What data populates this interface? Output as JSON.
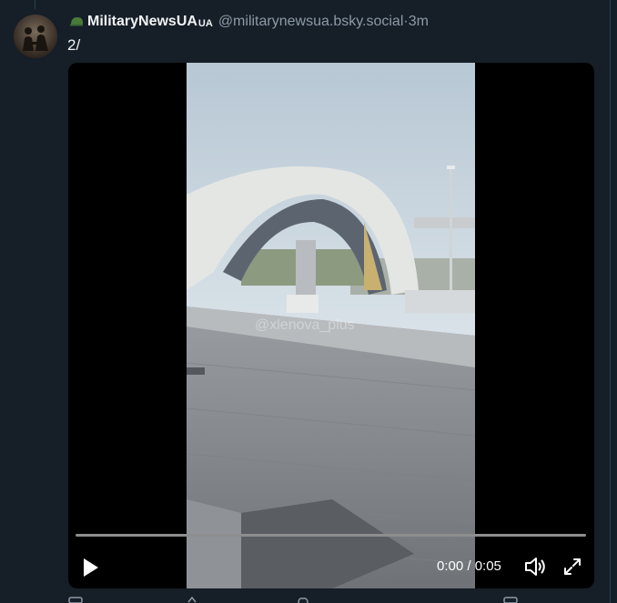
{
  "post": {
    "author_name": "MilitaryNewsUA",
    "author_suffix": "UA",
    "handle": "@militarynewsua.bsky.social",
    "separator": " · ",
    "time": "3m",
    "text": "2/"
  },
  "video": {
    "watermark": "@xlenova_plus",
    "time_display": "0:00 / 0:05",
    "progress": 0.0
  },
  "icons": {
    "avatar": "avatar-silhouette-icon",
    "helmet": "helmet-icon",
    "play": "play-icon",
    "volume": "volume-icon",
    "fullscreen": "fullscreen-icon"
  }
}
